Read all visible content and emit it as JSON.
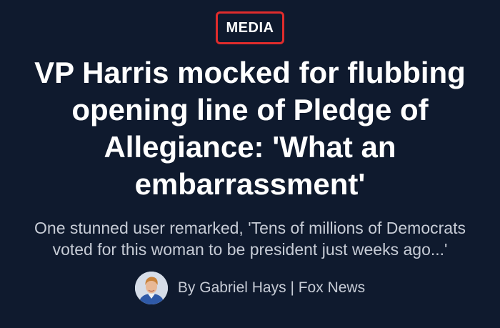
{
  "article": {
    "category": "MEDIA",
    "headline": "VP Harris mocked for flubbing opening line of Pledge of Allegiance: 'What an embarrassment'",
    "subheadline": "One stunned user remarked, 'Tens of millions of Democrats voted for this woman to be president just weeks ago...'",
    "byline": "By Gabriel Hays | Fox News"
  },
  "colors": {
    "background": "#0f1a2e",
    "badge_border": "#e02c2c",
    "headline": "#ffffff",
    "subtext": "#c7ccd6"
  },
  "icons": {
    "avatar": "author-photo"
  }
}
